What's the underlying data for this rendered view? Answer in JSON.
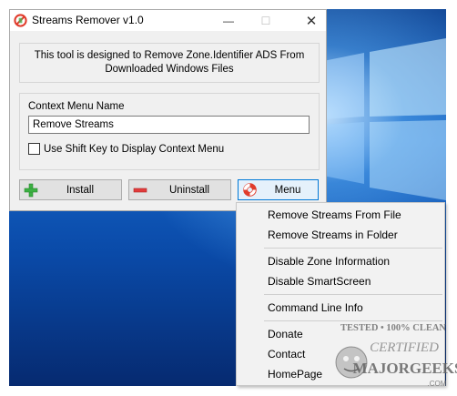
{
  "window": {
    "title": "Streams Remover v1.0",
    "controls": {
      "minimize": "—",
      "maximize": "☐",
      "close": "✕"
    }
  },
  "info": {
    "line1": "This tool is designed to Remove Zone.Identifier ADS From",
    "line2": "Downloaded Windows Files"
  },
  "context_menu_group": {
    "label": "Context Menu Name",
    "input_value": "Remove Streams",
    "shift_key_checkbox_label": "Use Shift Key to Display Context Menu",
    "shift_key_checked": false
  },
  "buttons": {
    "install": "Install",
    "uninstall": "Uninstall",
    "menu": "Menu"
  },
  "menu": {
    "items": [
      "Remove Streams From File",
      "Remove Streams in Folder",
      "Disable Zone Information",
      "Disable SmartScreen",
      "Command Line Info",
      "Donate",
      "Contact",
      "HomePage"
    ]
  },
  "watermark": {
    "line1": "TESTED • 100% CLEAN",
    "line2": "CERTIFIED",
    "line3": "MAJORGEEKS",
    "line4": ".COM"
  },
  "icons": {
    "app": "no-sign-icon",
    "install": "green-plus-icon",
    "uninstall": "red-minus-icon",
    "menu": "lifebuoy-icon"
  },
  "colors": {
    "install_green": "#3cb043",
    "uninstall_red": "#e23b3b",
    "menu_accent": "#0078d7",
    "lifebuoy_red": "#e03c2c"
  }
}
